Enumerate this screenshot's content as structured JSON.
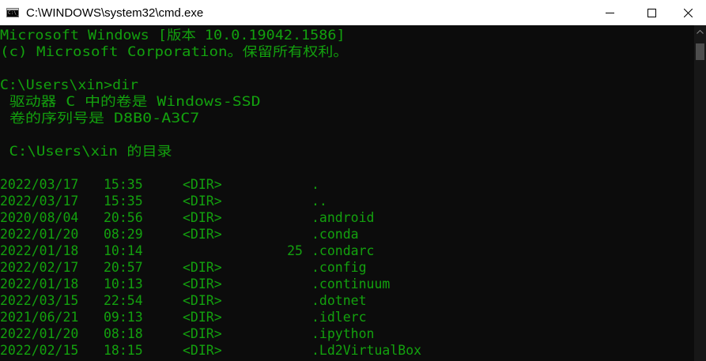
{
  "window": {
    "title": "C:\\WINDOWS\\system32\\cmd.exe",
    "icon_text": "C:\\_"
  },
  "caption": {
    "minimize": "minimize-icon",
    "maximize": "maximize-icon",
    "close": "close-icon"
  },
  "colors": {
    "console_bg": "#0c0c0c",
    "console_fg": "#13a10e",
    "titlebar_bg": "#ffffff"
  },
  "console": {
    "header": [
      "Microsoft Windows [版本 10.0.19042.1586]",
      "(c) Microsoft Corporation。保留所有权利。"
    ],
    "prompt": "C:\\Users\\xin>dir",
    "volume": " 驱动器 C 中的卷是 Windows-SSD",
    "serial": " 卷的序列号是 D8B0-A3C7",
    "dir_of": " C:\\Users\\xin 的目录",
    "entries": [
      {
        "date": "2022/03/17",
        "time": "15:35",
        "type": "<DIR>",
        "size": "",
        "name": "."
      },
      {
        "date": "2022/03/17",
        "time": "15:35",
        "type": "<DIR>",
        "size": "",
        "name": ".."
      },
      {
        "date": "2020/08/04",
        "time": "20:56",
        "type": "<DIR>",
        "size": "",
        "name": ".android"
      },
      {
        "date": "2022/01/20",
        "time": "08:29",
        "type": "<DIR>",
        "size": "",
        "name": ".conda"
      },
      {
        "date": "2022/01/18",
        "time": "10:14",
        "type": "",
        "size": "25",
        "name": ".condarc"
      },
      {
        "date": "2022/02/17",
        "time": "20:57",
        "type": "<DIR>",
        "size": "",
        "name": ".config"
      },
      {
        "date": "2022/01/18",
        "time": "10:13",
        "type": "<DIR>",
        "size": "",
        "name": ".continuum"
      },
      {
        "date": "2022/03/15",
        "time": "22:54",
        "type": "<DIR>",
        "size": "",
        "name": ".dotnet"
      },
      {
        "date": "2021/06/21",
        "time": "09:13",
        "type": "<DIR>",
        "size": "",
        "name": ".idlerc"
      },
      {
        "date": "2022/01/20",
        "time": "08:18",
        "type": "<DIR>",
        "size": "",
        "name": ".ipython"
      },
      {
        "date": "2022/02/15",
        "time": "18:15",
        "type": "<DIR>",
        "size": "",
        "name": ".Ld2VirtualBox"
      }
    ]
  }
}
